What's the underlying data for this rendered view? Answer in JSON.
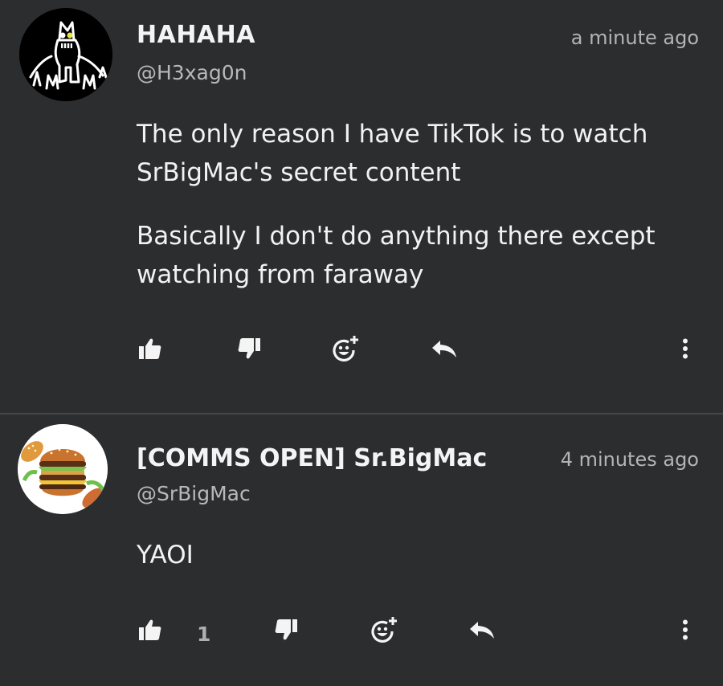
{
  "posts": [
    {
      "display_name": "HAHAHA",
      "handle": "@H3xag0n",
      "timestamp": "a minute ago",
      "paragraphs": [
        "The only reason I have TikTok is to watch SrBigMac's secret content",
        "Basically I don't do anything there except watching from faraway"
      ],
      "like_count": "",
      "avatar_icon": "cat-drawing-avatar"
    },
    {
      "display_name": "[COMMS OPEN] Sr.BigMac",
      "handle": "@SrBigMac",
      "timestamp": "4 minutes ago",
      "paragraphs": [
        "YAOI"
      ],
      "like_count": "1",
      "avatar_icon": "burger-avatar"
    }
  ],
  "icons": {
    "like": "thumbs-up-icon",
    "dislike": "thumbs-down-icon",
    "react": "add-reaction-icon",
    "reply": "reply-arrow-icon",
    "more": "more-vertical-icon"
  },
  "colors": {
    "background": "#2b2d2e",
    "divider": "#454748",
    "text": "#f2f2f2",
    "muted": "#b4b4b4"
  }
}
